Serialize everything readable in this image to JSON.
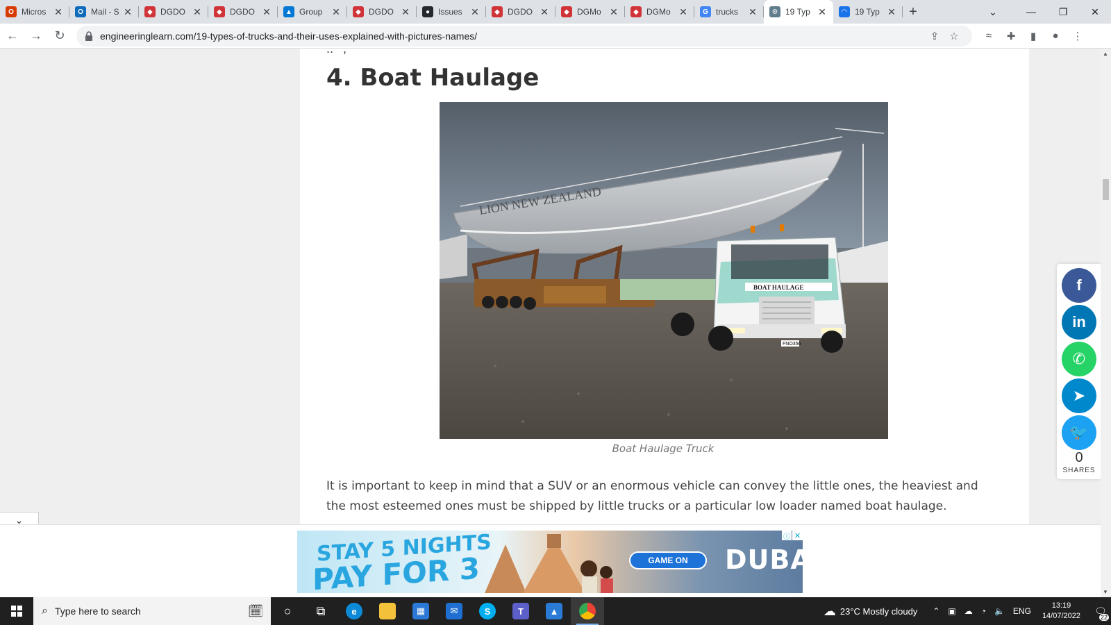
{
  "browser": {
    "tabs": [
      {
        "title": "Micros",
        "icon": "office-icon",
        "color": "#d83b01",
        "glyph": "O"
      },
      {
        "title": "Mail - S",
        "icon": "outlook-icon",
        "color": "#0f6cbd",
        "glyph": "O"
      },
      {
        "title": "DGDO",
        "icon": "dgdo-icon",
        "color": "#d13438",
        "glyph": "◆"
      },
      {
        "title": "DGDO",
        "icon": "dgdo-icon",
        "color": "#d13438",
        "glyph": "◆"
      },
      {
        "title": "Group",
        "icon": "azure-devops-icon",
        "color": "#0078d4",
        "glyph": "▲"
      },
      {
        "title": "DGDO",
        "icon": "dgdo-icon",
        "color": "#d13438",
        "glyph": "◆"
      },
      {
        "title": "Issues",
        "icon": "github-icon",
        "color": "#24292f",
        "glyph": "●"
      },
      {
        "title": "DGDO",
        "icon": "dgdo-icon",
        "color": "#d13438",
        "glyph": "◆"
      },
      {
        "title": "DGMo",
        "icon": "dgmo-icon",
        "color": "#d13438",
        "glyph": "◆"
      },
      {
        "title": "DGMo",
        "icon": "dgmo-icon",
        "color": "#d13438",
        "glyph": "◆"
      },
      {
        "title": "trucks",
        "icon": "google-icon",
        "color": "#4285f4",
        "glyph": "G"
      },
      {
        "title": "19 Typ",
        "icon": "engineering-learn-icon",
        "color": "#607d8b",
        "glyph": "⚙",
        "active": true
      },
      {
        "title": "19 Typ",
        "icon": "loading-icon",
        "color": "#1a73e8",
        "glyph": "◠"
      }
    ],
    "url": "engineeringlearn.com/19-types-of-trucks-and-their-uses-explained-with-pictures-names/"
  },
  "article": {
    "heading": "4. Boat Haulage",
    "caption": "Boat Haulage Truck",
    "paragraph": "It is important to keep in mind that a SUV or an enormous vehicle can convey the little ones, the heaviest and the most esteemed ones must be shipped by little trucks or a particular low loader named boat haulage.",
    "image": {
      "boat_name": "LION NEW ZEALAND",
      "truck_label": "BOAT HAULAGE",
      "plate": "FNO356"
    }
  },
  "share": {
    "count": "0",
    "label": "SHARES",
    "buttons": [
      {
        "name": "facebook-share-button",
        "glyph": "f",
        "color": "#3b5998"
      },
      {
        "name": "linkedin-share-button",
        "glyph": "in",
        "color": "#0077b5"
      },
      {
        "name": "whatsapp-share-button",
        "glyph": "✆",
        "color": "#25d366"
      },
      {
        "name": "telegram-share-button",
        "glyph": "➤",
        "color": "#0088cc"
      },
      {
        "name": "twitter-share-button",
        "glyph": "🐦",
        "color": "#1da1f2"
      }
    ]
  },
  "ad": {
    "line1": "STAY 5 NIGHTS",
    "line2": "PAY FOR 3",
    "cta": "GAME ON",
    "brand": "DUBAI"
  },
  "taskbar": {
    "search_placeholder": "Type here to search",
    "weather": "23°C  Mostly cloudy",
    "language": "ENG",
    "time": "13:19",
    "date": "14/07/2022",
    "notifications": "22"
  }
}
